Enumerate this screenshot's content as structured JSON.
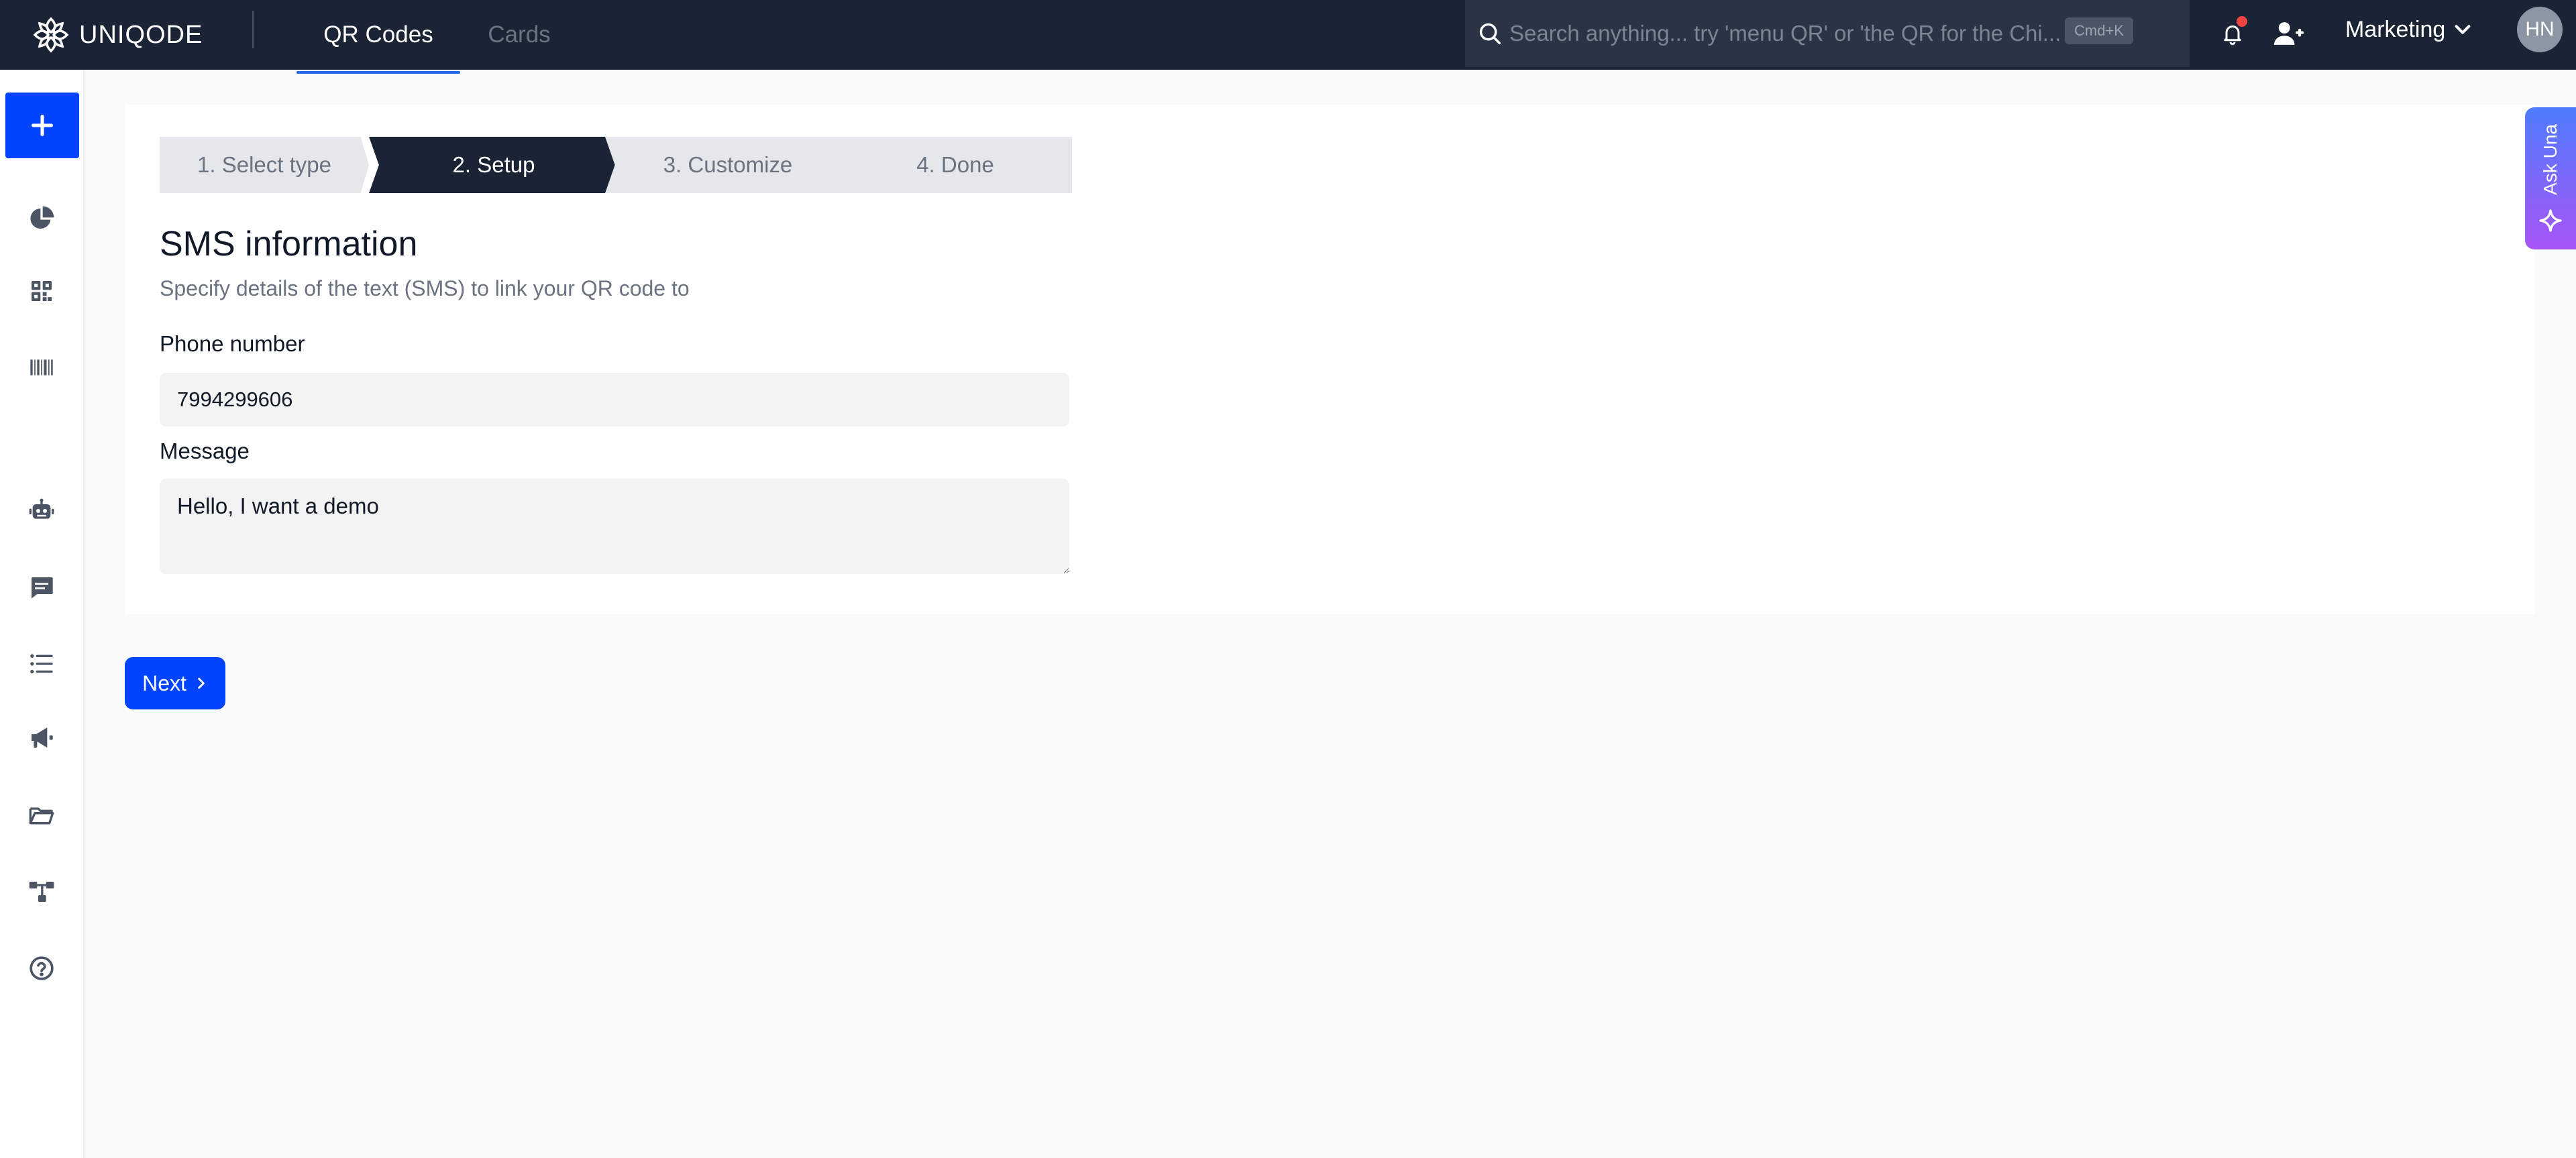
{
  "app": {
    "logo_text": "UNIQODE"
  },
  "nav": {
    "tabs": [
      {
        "label": "QR Codes",
        "active": true
      },
      {
        "label": "Cards",
        "active": false
      }
    ],
    "search": {
      "placeholder": "Search anything... try 'menu QR' or 'the QR for the Chi...",
      "shortcut": "Cmd+K"
    },
    "workspace": "Marketing",
    "avatar_initials": "HN"
  },
  "sidebar": {
    "items": [
      {
        "icon": "plus-icon",
        "name": "create"
      },
      {
        "icon": "pie-chart-icon",
        "name": "analytics"
      },
      {
        "icon": "qr-grid-icon",
        "name": "qr-codes"
      },
      {
        "icon": "barcode-icon",
        "name": "barcodes"
      },
      {
        "icon": "robot-icon",
        "name": "automation"
      },
      {
        "icon": "message-icon",
        "name": "messages"
      },
      {
        "icon": "list-icon",
        "name": "lists"
      },
      {
        "icon": "megaphone-icon",
        "name": "campaigns"
      },
      {
        "icon": "folder-icon",
        "name": "folders"
      },
      {
        "icon": "hierarchy-icon",
        "name": "organization"
      },
      {
        "icon": "help-icon",
        "name": "help"
      }
    ]
  },
  "wizard": {
    "steps": [
      {
        "label": "1. Select type",
        "state": "complete"
      },
      {
        "label": "2. Setup",
        "state": "active"
      },
      {
        "label": "3. Customize",
        "state": "upcoming"
      },
      {
        "label": "4. Done",
        "state": "upcoming"
      }
    ]
  },
  "form": {
    "title": "SMS information",
    "subtitle": "Specify details of the text (SMS) to link your QR code to",
    "phone": {
      "label": "Phone number",
      "value": "7994299606"
    },
    "message": {
      "label": "Message",
      "value": "Hello, I want a demo"
    }
  },
  "actions": {
    "next_label": "Next"
  },
  "assistant": {
    "label": "Ask Una"
  },
  "colors": {
    "topbar": "#1b2434",
    "primary": "#0044ff",
    "step_active": "#1b2434",
    "step_inactive": "#e5e7eb",
    "notification_dot": "#ef4444"
  }
}
